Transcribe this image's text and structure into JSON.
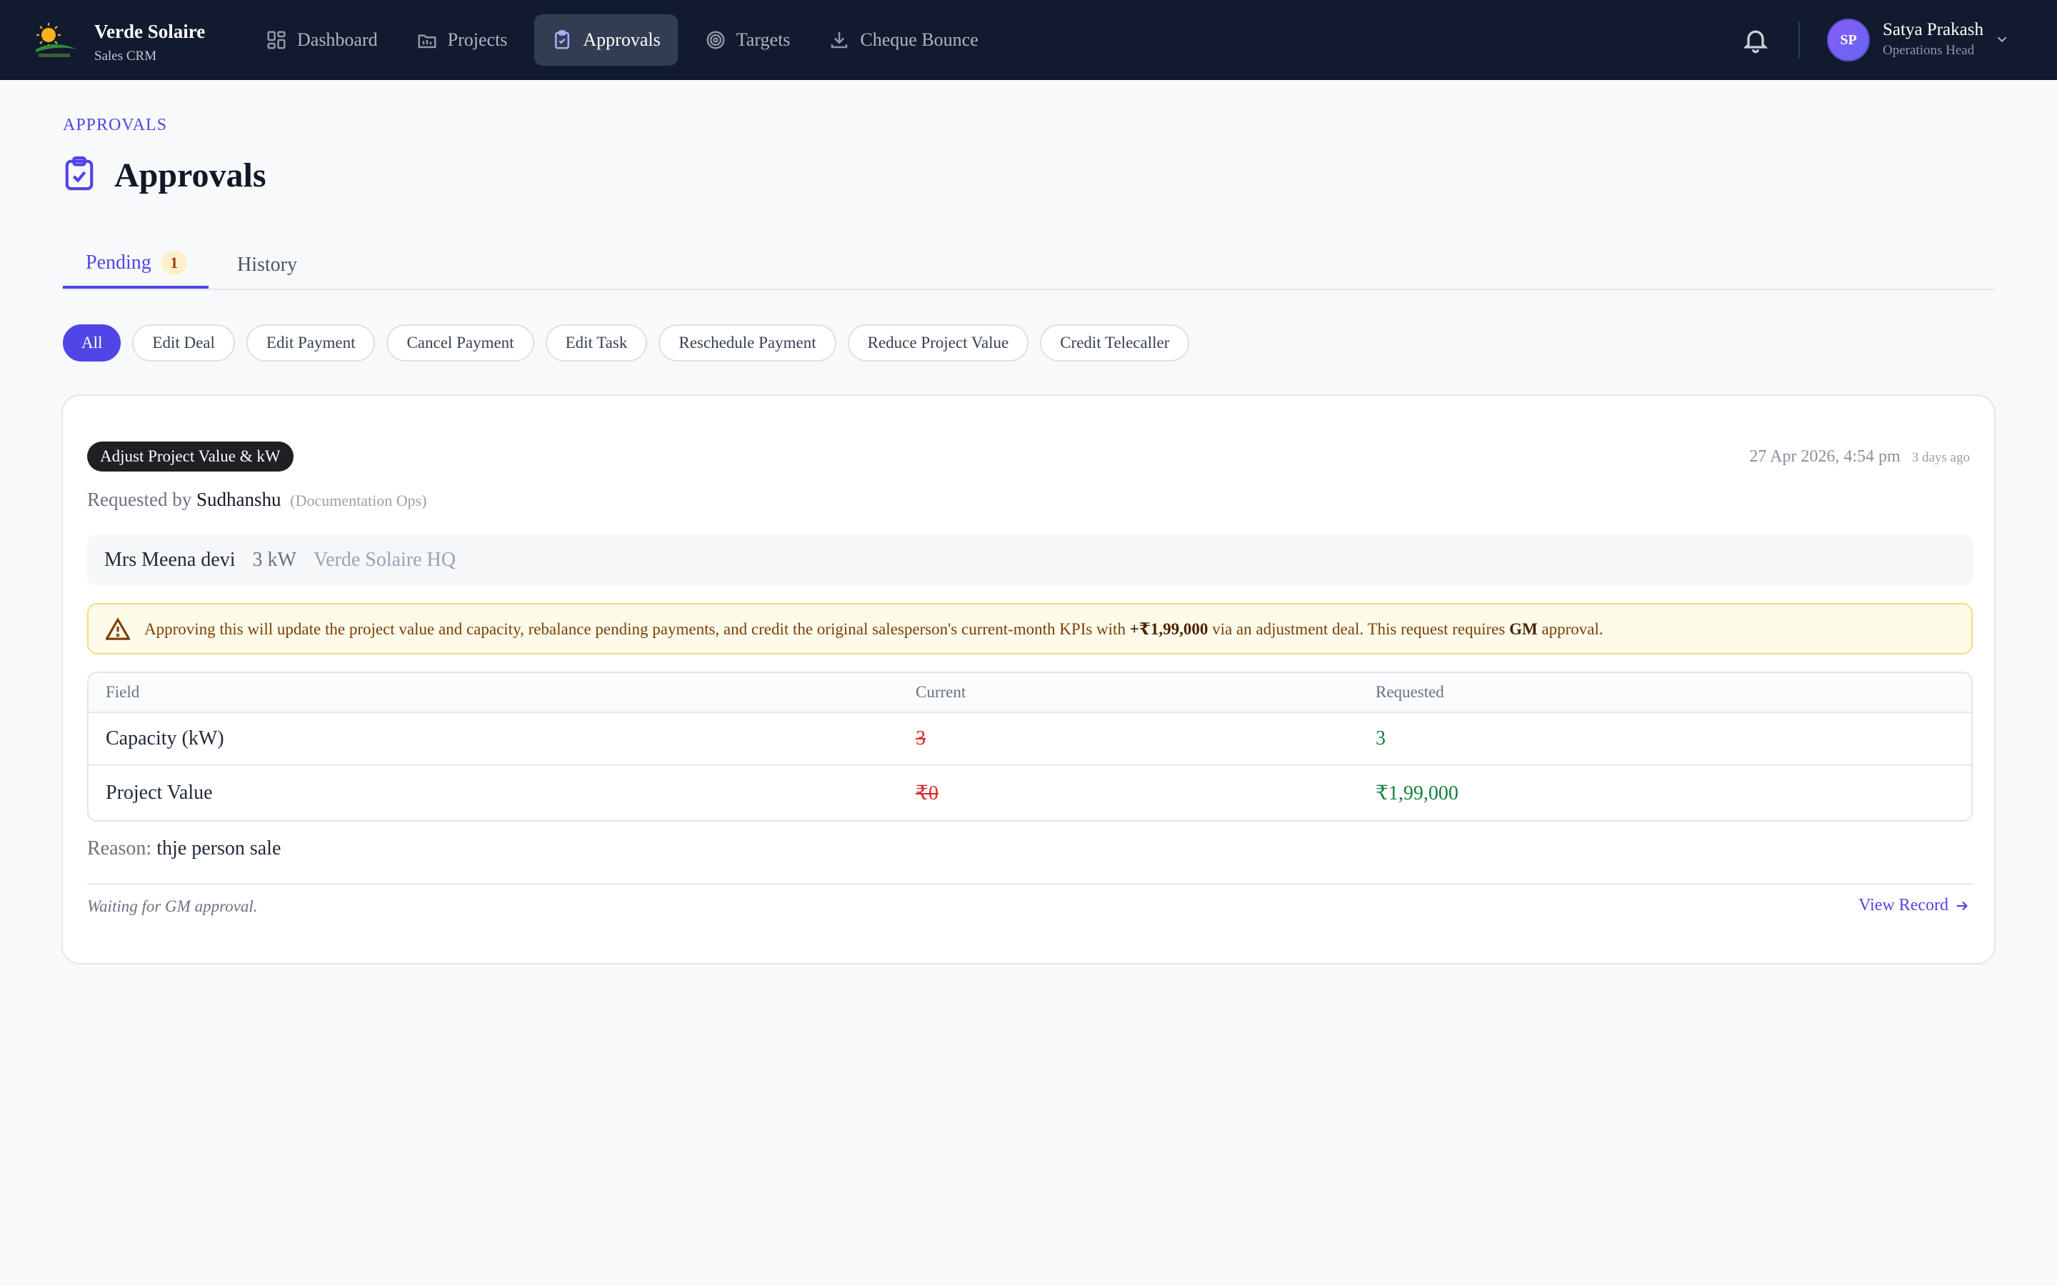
{
  "brand": {
    "title": "Verde Solaire",
    "subtitle": "Sales CRM"
  },
  "nav": [
    {
      "label": "Dashboard",
      "icon": "dashboard-icon",
      "active": false
    },
    {
      "label": "Projects",
      "icon": "projects-icon",
      "active": false
    },
    {
      "label": "Approvals",
      "icon": "clipboard-check-icon",
      "active": true
    },
    {
      "label": "Targets",
      "icon": "target-icon",
      "active": false
    },
    {
      "label": "Cheque Bounce",
      "icon": "download-icon",
      "active": false
    }
  ],
  "user": {
    "initials": "SP",
    "name": "Satya Prakash",
    "role": "Operations Head"
  },
  "page": {
    "breadcrumb": "APPROVALS",
    "title": "Approvals"
  },
  "tabs": {
    "pending_label": "Pending",
    "pending_count": "1",
    "history_label": "History"
  },
  "filters": [
    "All",
    "Edit Deal",
    "Edit Payment",
    "Cancel Payment",
    "Edit Task",
    "Reschedule Payment",
    "Reduce Project Value",
    "Credit Telecaller"
  ],
  "request": {
    "type": "Adjust Project Value & kW",
    "date": "27 Apr 2026, 4:54 pm",
    "ago": "3 days ago",
    "requested_by_prefix": "Requested by",
    "requester": "Sudhanshu",
    "requester_dept": "(Documentation Ops)",
    "customer": "Mrs Meena devi",
    "capacity": "3 kW",
    "branch": "Verde Solaire HQ",
    "warning": {
      "part1": "Approving this will update the project value and capacity, rebalance pending payments, and credit the original salesperson's current-month KPIs with",
      "amount": "+₹1,99,000",
      "part2": "via an adjustment deal. This request requires",
      "role": "GM",
      "part3": "approval."
    },
    "table": {
      "headers": [
        "Field",
        "Current",
        "Requested"
      ],
      "rows": [
        {
          "field": "Capacity (kW)",
          "current": "3",
          "requested": "3"
        },
        {
          "field": "Project Value",
          "current": "₹0",
          "requested": "₹1,99,000"
        }
      ]
    },
    "reason_label": "Reason:",
    "reason": "thje person sale",
    "status": "Waiting for GM approval.",
    "view_record": "View Record"
  },
  "colors": {
    "accent": "#4f46e5",
    "nav_bg": "#111a2e",
    "warning_bg": "#fefbea",
    "old": "#dc2626",
    "new": "#15803d"
  }
}
